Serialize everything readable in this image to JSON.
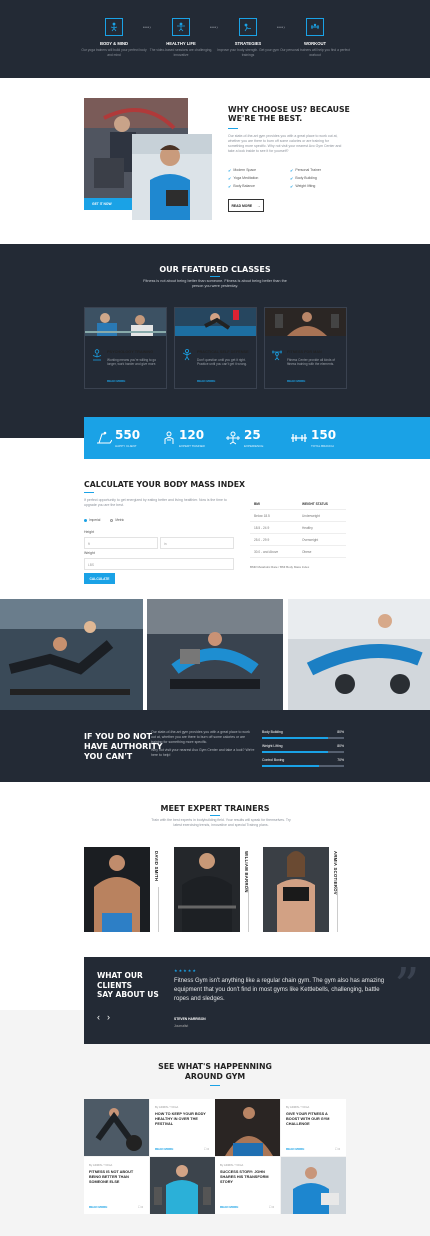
{
  "steps": [
    {
      "title": "BODY & MIND",
      "desc": "Our yoga trainers will build your perfect body and mind"
    },
    {
      "title": "HEALTHY LIFE",
      "desc": "The video-based sessions are challenging, innovative"
    },
    {
      "title": "STRATEGIES",
      "desc": "Improve your body strength. Get your gym trainings"
    },
    {
      "title": "WORKOUT",
      "desc": "Our personal trainers will help you find a perfect workout"
    }
  ],
  "step_arrow": "• • • ›",
  "why": {
    "title_line1": "WHY CHOOSE US? BECAUSE",
    "title_line2": "WE'RE THE BEST.",
    "body": "Our state-of-the-art gym provides you with a great place to work out at, whether you are there to burn off some calories or are training for something more specific. Why not visit your nearest Avo Gym Center and take a look inside to see it for yourself?",
    "features_left": [
      "Modern Space",
      "Yoga Meditation",
      "Body Balance"
    ],
    "features_right": [
      "Personal Trainer",
      "Body Building",
      "Weight lifting"
    ],
    "badge": "GET IT NOW",
    "button": "READ MORE",
    "button_arrow": "→"
  },
  "classes": {
    "title": "OUR FEATURED CLASSES",
    "subtitle_1": "Fitness is not about being better than someone. Fitness is about being better than the",
    "subtitle_2": "person you were yesterday.",
    "items": [
      {
        "title": "PSYCHOLOGY TRAINING",
        "desc": "Working means you're willing to go longer, work harder and give more.",
        "more": "READ MORE",
        "icon": "meditation-icon"
      },
      {
        "title": "PRACTICAL SELF DEFENSE",
        "desc": "Don't question until you get it right. Practice until you can't get it wrong.",
        "more": "READ MORE",
        "icon": "fighter-icon"
      },
      {
        "title": "FITNESS FOR MAN",
        "desc": "Fitness Center provide all kinds of fitness training with the elements.",
        "more": "READ MORE",
        "icon": "weightlifter-icon"
      }
    ]
  },
  "stats": [
    {
      "value": "550",
      "label": "HAPPY CLIENT",
      "icon": "treadmill-icon"
    },
    {
      "value": "120",
      "label": "EXPERT TRAINER",
      "icon": "trainer-icon"
    },
    {
      "value": "25",
      "label": "EXPERIENCE",
      "icon": "weights-icon"
    },
    {
      "value": "150",
      "label": "TOTAL BRANCH",
      "icon": "dumbbell-icon"
    }
  ],
  "bmi": {
    "title": "CALCULATE YOUR BODY MASS INDEX",
    "desc": "If perfect opportunity to get energized by eating better and living healthier. Now is the time to upgrade you are the best.",
    "units": [
      "Imperial",
      "Metric"
    ],
    "height_label": "Height",
    "weight_label": "Weight",
    "height_ph": "ft",
    "height_ph2": "in",
    "weight_ph": "LBS",
    "button": "CALCULATE",
    "table_head": [
      "BMI",
      "WEIGHT STATUS"
    ],
    "table_rows": [
      [
        "Below 18.5",
        "Underweight"
      ],
      [
        "18.5 - 24.9",
        "Healthy"
      ],
      [
        "25.0 - 29.9",
        "Overweight"
      ],
      [
        "30.0 - and Above",
        "Obese"
      ]
    ],
    "note": "BMR Metabolic Rate / BMI Body Mass Index"
  },
  "authority": {
    "title_1": "IF YOU DO NOT",
    "title_2": "HAVE AUTHORITY",
    "title_3": "YOU CAN'T",
    "body": "Our state-of-the-art gym provides you with a great place to work out at, whether you are there to burn off some calories or are training for something more specific.",
    "body2": "Why not visit your nearest Avo Gym Center and take a look? We're here to help!",
    "bars": [
      {
        "label": "Body Building",
        "pct": "80%",
        "value": 0.8
      },
      {
        "label": "Weight Lifting",
        "pct": "80%",
        "value": 0.8
      },
      {
        "label": "Control Boxing",
        "pct": "70%",
        "value": 0.7
      }
    ]
  },
  "trainers": {
    "title": "MEET EXPERT TRAINERS",
    "desc": "Train with the best experts in bodybuilding field. Your results will speak for themselves. Try latest exercising trends, innovative and special Trainng plans.",
    "items": [
      {
        "name": "DAVID SMITH"
      },
      {
        "name": "WILLIAM BARRON"
      },
      {
        "name": "ARMIA SCOTIEROV"
      }
    ]
  },
  "testimonial": {
    "title_1": "WHAT OUR",
    "title_2": "CLIENTS",
    "title_3": "SAY ABOUT US",
    "stars": "★★★★★",
    "quote": "Fitness Gym isn't anything like a regular chain gym. The gym also has amazing equipment that you don't find in most gyms like Kettlebells, challenging, battle ropes and sledges.",
    "author": "STEVEN HARRISON",
    "role": "Journalist",
    "prev": "‹",
    "next": "›",
    "quote_mark": "”"
  },
  "blog": {
    "title_1": "SEE WHAT'S HAPPENNING",
    "title_2": "AROUND GYM",
    "posts": [
      {
        "meta": "By ADMIN / YOGA",
        "title": "HOW TO KEEP YOUR BODY HEALTHY IN OVER THE FESTIVAL",
        "more": "READ MORE",
        "comments": "0"
      },
      {
        "meta": "By ADMIN / YOGA",
        "title": "GIVE YOUR FITNESS A BOOST WITH OUR GYM CHALLENGE",
        "more": "READ MORE",
        "comments": "0"
      },
      {
        "meta": "By ADMIN / YOGA",
        "title": "FITNESS IS NOT ABOUT BEING BETTER THAN SOMEONE ELSE",
        "more": "READ MORE",
        "comments": "0"
      },
      {
        "meta": "By ADMIN / YOGA",
        "title": "SUCCESS STORY: JOHN SHARES HIS TRANSFORM STORY",
        "more": "READ MORE",
        "comments": "0"
      }
    ]
  },
  "colors": {
    "accent": "#1aa2e6",
    "dark": "#232a35"
  }
}
